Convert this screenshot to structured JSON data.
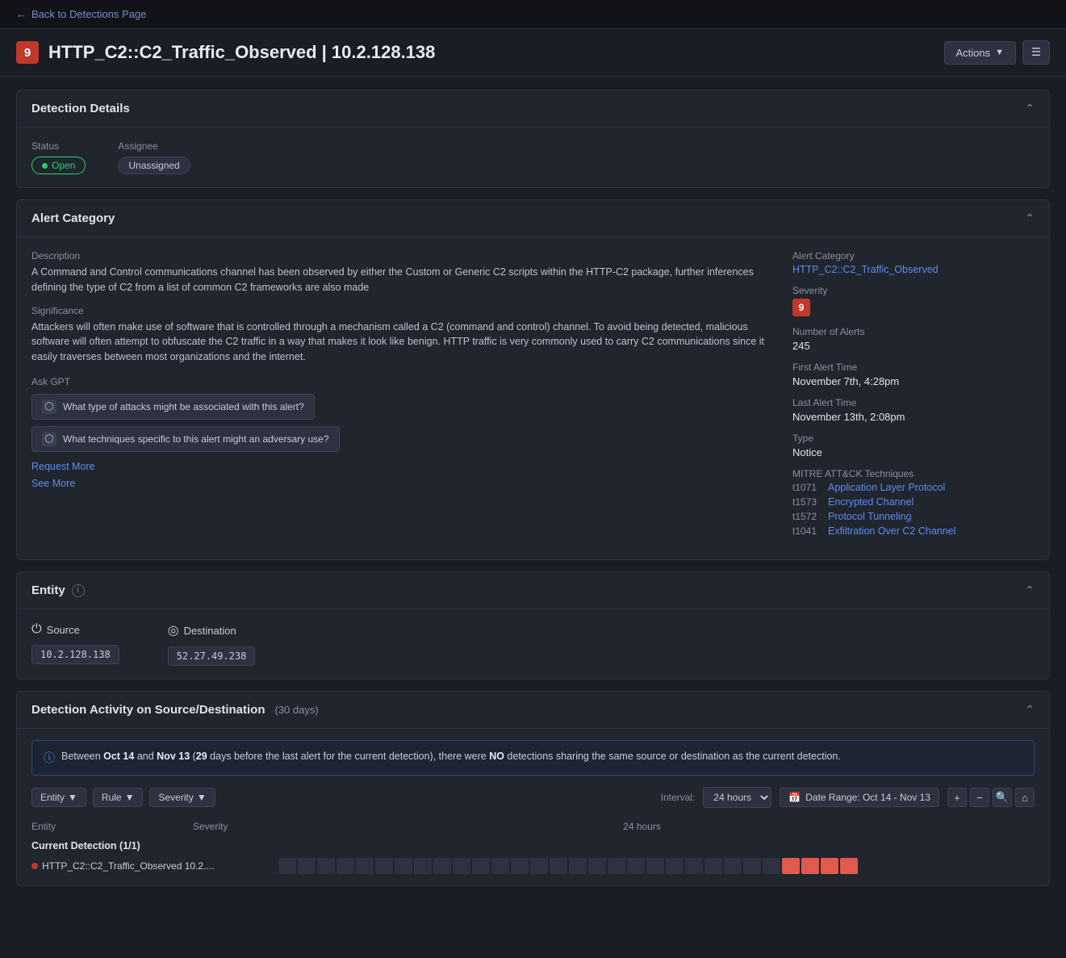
{
  "topbar": {
    "back_label": "Back to Detections Page"
  },
  "header": {
    "severity_number": "9",
    "title": "HTTP_C2::C2_Traffic_Observed | 10.2.128.138",
    "actions_label": "Actions",
    "notes_icon": "notes"
  },
  "detection_details": {
    "card_title": "Detection Details",
    "status_label": "Status",
    "status_value": "Open",
    "assignee_label": "Assignee",
    "assignee_value": "Unassigned"
  },
  "alert_category": {
    "card_title": "Alert Category",
    "description_label": "Description",
    "description_text": "A Command and Control communications channel has been observed by either the Custom or Generic C2 scripts within the HTTP-C2 package, further inferences defining the type of C2 from a list of common C2 frameworks are also made",
    "significance_label": "Significance",
    "significance_text": "Attackers will often make use of software that is controlled through a mechanism called a C2 (command and control) channel. To avoid being detected, malicious software will often attempt to obfuscate the C2 traffic in a way that makes it look like benign. HTTP traffic is very commonly used to carry C2 communications since it easily traverses between most organizations and the internet.",
    "ask_gpt_label": "Ask GPT",
    "gpt_btn1": "What type of attacks might be associated with this alert?",
    "gpt_btn2": "What techniques specific to this alert might an adversary use?",
    "request_more": "Request More",
    "see_more": "See More",
    "alert_category_label": "Alert Category",
    "alert_category_value": "HTTP_C2::C2_Traffic_Observed",
    "severity_label": "Severity",
    "severity_value": "9",
    "num_alerts_label": "Number of Alerts",
    "num_alerts_value": "245",
    "first_alert_label": "First Alert Time",
    "first_alert_value": "November 7th, 4:28pm",
    "last_alert_label": "Last Alert Time",
    "last_alert_value": "November 13th, 2:08pm",
    "type_label": "Type",
    "type_value": "Notice",
    "mitre_label": "MITRE ATT&CK Techniques",
    "mitre_techniques": [
      {
        "id": "t1071",
        "label": "Application Layer Protocol"
      },
      {
        "id": "t1573",
        "label": "Encrypted Channel"
      },
      {
        "id": "t1572",
        "label": "Protocol Tunneling"
      },
      {
        "id": "t1041",
        "label": "Exfiltration Over C2 Channel"
      }
    ]
  },
  "entity": {
    "card_title": "Entity",
    "source_label": "Source",
    "source_icon": "⏻",
    "source_ip": "10.2.128.138",
    "destination_label": "Destination",
    "destination_icon": "◎",
    "destination_ip": "52.27.49.238"
  },
  "detection_activity": {
    "card_title": "Detection Activity on Source/Destination",
    "days_label": "(30 days)",
    "info_text_before1": "Between ",
    "info_oct14": "Oct 14",
    "info_text_mid1": " and ",
    "info_nov13": "Nov 13",
    "info_text_mid2": " (",
    "info_29days": "29",
    "info_text_after": " days before the last alert for the current detection), there were ",
    "info_no": "NO",
    "info_text_end": " detections sharing the same source or destination as the current detection.",
    "entity_filter": "Entity",
    "rule_filter": "Rule",
    "severity_filter": "Severity",
    "interval_label": "Interval:",
    "interval_value": "24 hours",
    "date_range_label": "Date Range: Oct 14 - Nov 13",
    "current_detection_label": "Current Detection (1/1)",
    "detection_name": "HTTP_C2::C2_Traffic_Observed 10.2....",
    "entity_col": "Entity",
    "severity_col": "Severity",
    "hours_col": "24 hours"
  }
}
